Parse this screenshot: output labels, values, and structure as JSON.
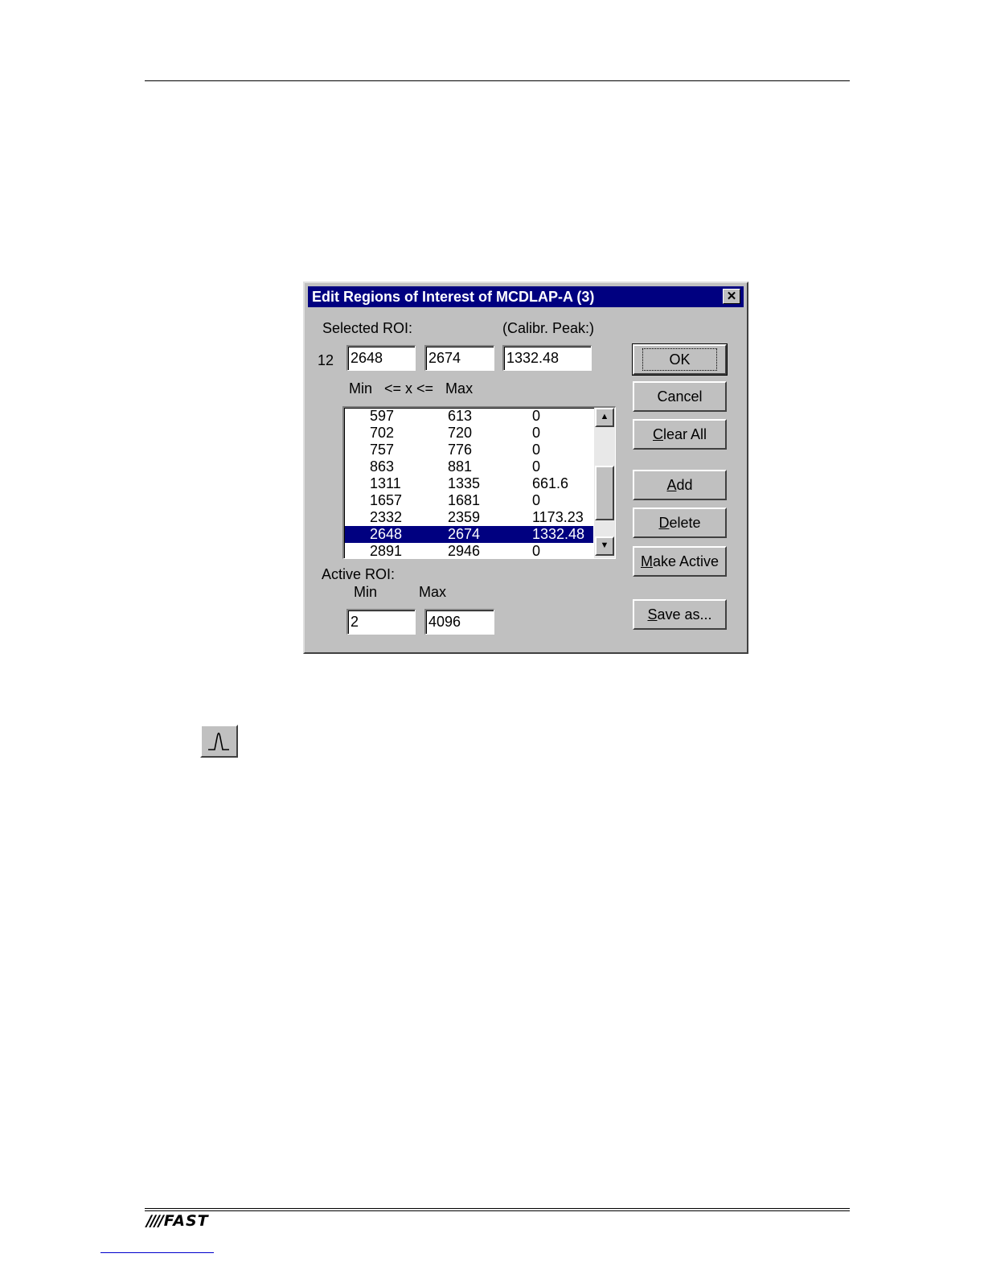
{
  "dialog": {
    "title": "Edit Regions of Interest of MCDLAP-A (3)",
    "selected_roi_label": "Selected ROI:",
    "calibr_peak_label": "(Calibr. Peak:)",
    "selected_index": "12",
    "selected_min": "2648",
    "selected_max": "2674",
    "selected_peak": "1332.48",
    "range_label": "Min   <= x <=   Max",
    "roi_rows": [
      {
        "min": "597",
        "max": "613",
        "peak": "0"
      },
      {
        "min": "702",
        "max": "720",
        "peak": "0"
      },
      {
        "min": "757",
        "max": "776",
        "peak": "0"
      },
      {
        "min": "863",
        "max": "881",
        "peak": "0"
      },
      {
        "min": "1311",
        "max": "1335",
        "peak": "661.6"
      },
      {
        "min": "1657",
        "max": "1681",
        "peak": "0"
      },
      {
        "min": "2332",
        "max": "2359",
        "peak": "1173.23"
      },
      {
        "min": "2648",
        "max": "2674",
        "peak": "1332.48"
      },
      {
        "min": "2891",
        "max": "2946",
        "peak": "0"
      }
    ],
    "active_roi_label": "Active ROI:",
    "active_min_label": "Min",
    "active_max_label": "Max",
    "active_min": "2",
    "active_max": "4096",
    "buttons": {
      "ok": "OK",
      "cancel": "Cancel",
      "clear_all_u": "C",
      "clear_all_rest": "lear All",
      "add_u": "A",
      "add_rest": "dd",
      "delete_u": "D",
      "delete_rest": "elete",
      "make_active_u": "M",
      "make_active_rest": "ake Active",
      "save_as_u": "S",
      "save_as_rest": "ave as..."
    }
  },
  "footer": {
    "logo_stripes": "////",
    "logo_text": "FAST"
  }
}
